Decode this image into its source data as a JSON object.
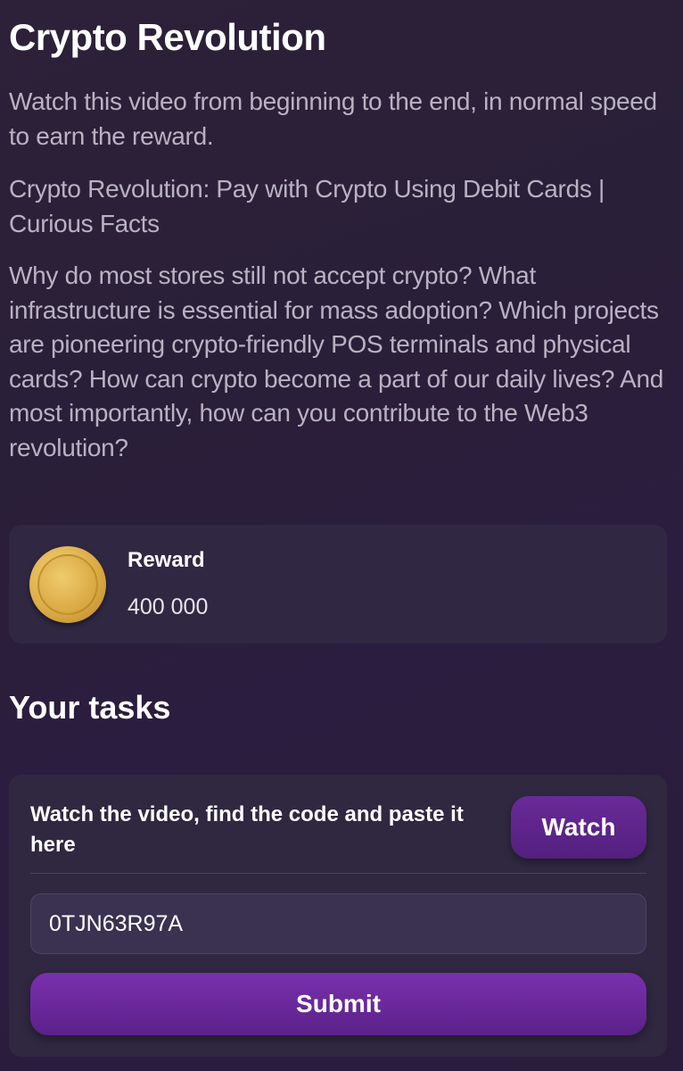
{
  "page": {
    "title": "Crypto Revolution",
    "instruction": "Watch this video from beginning to the end, in normal speed to earn the reward.",
    "video_title": "Crypto Revolution: Pay with Crypto Using Debit Cards | Curious Facts",
    "description": "Why do most stores still not accept crypto? What infrastructure is essential for mass adoption? Which projects are pioneering crypto-friendly POS terminals and physical cards? How can crypto become a part of our daily lives? And most importantly, how can you contribute to the Web3 revolution?"
  },
  "reward": {
    "icon": "gold-coin-icon",
    "label": "Reward",
    "value": "400 000"
  },
  "tasks": {
    "heading": "Your tasks",
    "items": [
      {
        "description": "Watch the video, find the code and paste it here",
        "watch_label": "Watch",
        "code_value": "0TJN63R97A",
        "submit_label": "Submit"
      }
    ]
  },
  "colors": {
    "background": "#2a1f38",
    "card": "#302842",
    "accent_purple": "#6a2a98",
    "coin_gold": "#dcac45",
    "muted_text": "#b9b2c2"
  }
}
